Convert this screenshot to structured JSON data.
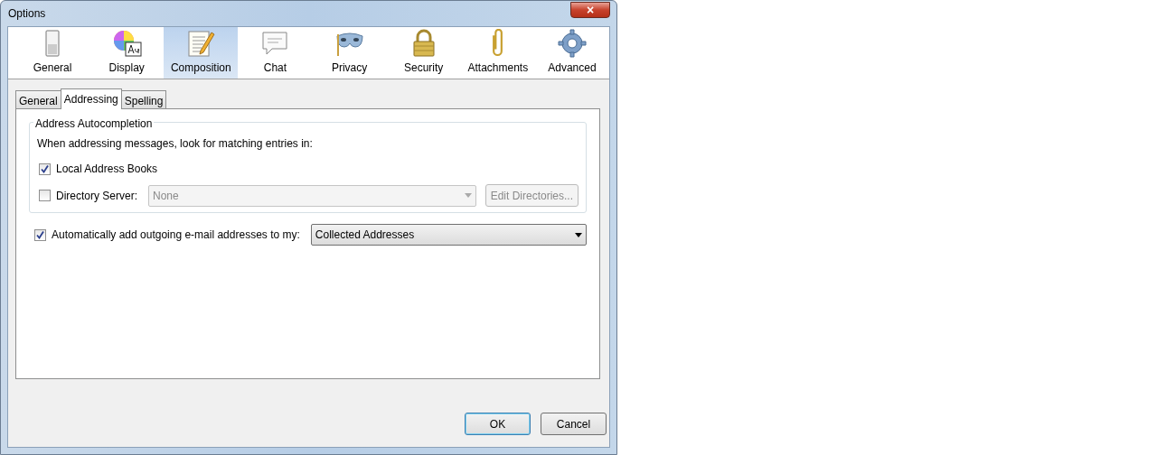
{
  "window": {
    "title": "Options",
    "close": "×"
  },
  "panes": [
    {
      "label": "General",
      "kind": "switch",
      "selected": false
    },
    {
      "label": "Display",
      "kind": "display",
      "selected": false
    },
    {
      "label": "Composition",
      "kind": "compose",
      "selected": true
    },
    {
      "label": "Chat",
      "kind": "chat",
      "selected": false
    },
    {
      "label": "Privacy",
      "kind": "mask",
      "selected": false
    },
    {
      "label": "Security",
      "kind": "lock",
      "selected": false
    },
    {
      "label": "Attachments",
      "kind": "clip",
      "selected": false
    },
    {
      "label": "Advanced",
      "kind": "gear",
      "selected": false
    }
  ],
  "tabs": [
    {
      "label": "General",
      "selected": false
    },
    {
      "label": "Addressing",
      "selected": true
    },
    {
      "label": "Spelling",
      "selected": false
    }
  ],
  "autocompletion": {
    "legend": "Address Autocompletion",
    "intro": "When addressing messages, look for matching entries in:",
    "local": {
      "label": "Local Address Books",
      "checked": true
    },
    "directory": {
      "label": "Directory Server:",
      "checked": false,
      "value": "None",
      "disabled": true,
      "button": "Edit Directories..."
    }
  },
  "auto_add": {
    "label": "Automatically add outgoing e-mail addresses to my:",
    "checked": true,
    "value": "Collected Addresses"
  },
  "buttons": [
    {
      "label": "OK",
      "default": true
    },
    {
      "label": "Cancel",
      "default": false
    }
  ]
}
